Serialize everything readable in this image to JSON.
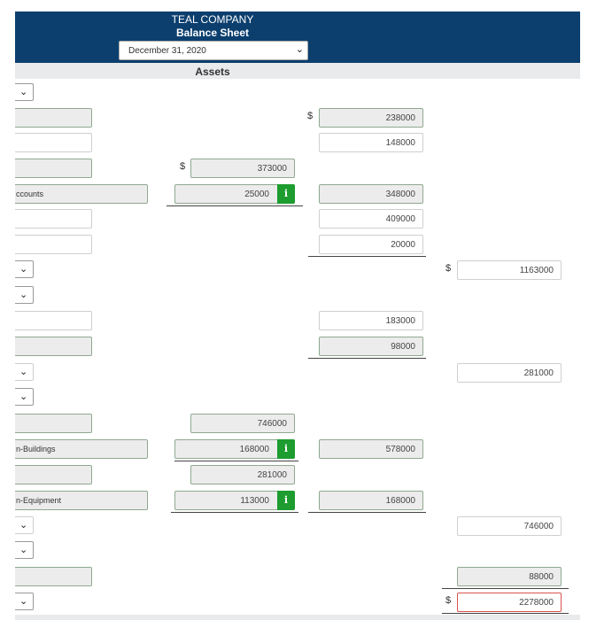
{
  "header": {
    "company": "TEAL COMPANY",
    "title": "Balance Sheet",
    "date_select": "December 31, 2020",
    "section": "Assets"
  },
  "currency_symbol": "$",
  "rows": {
    "r1_col2": "238000",
    "r2_col2": "148000",
    "r3_col1": "373000",
    "r4_label": "ccounts",
    "r4_col1": "25000",
    "r4_col2": "348000",
    "r5_col2": "409000",
    "r6_col2": "20000",
    "r7_col3": "1163000",
    "r9_col2": "183000",
    "r10_col2": "98000",
    "r11_col3": "281000",
    "r13_col1": "746000",
    "r14_label": "n-Buildings",
    "r14_col1": "168000",
    "r14_col2": "578000",
    "r15_col1": "281000",
    "r16_label": "n-Equipment",
    "r16_col1": "113000",
    "r16_col2": "168000",
    "r17_col3": "746000",
    "r19_col3": "88000",
    "r20_col3": "2278000"
  },
  "icons": {
    "info": "i",
    "chevron": "⌄"
  }
}
